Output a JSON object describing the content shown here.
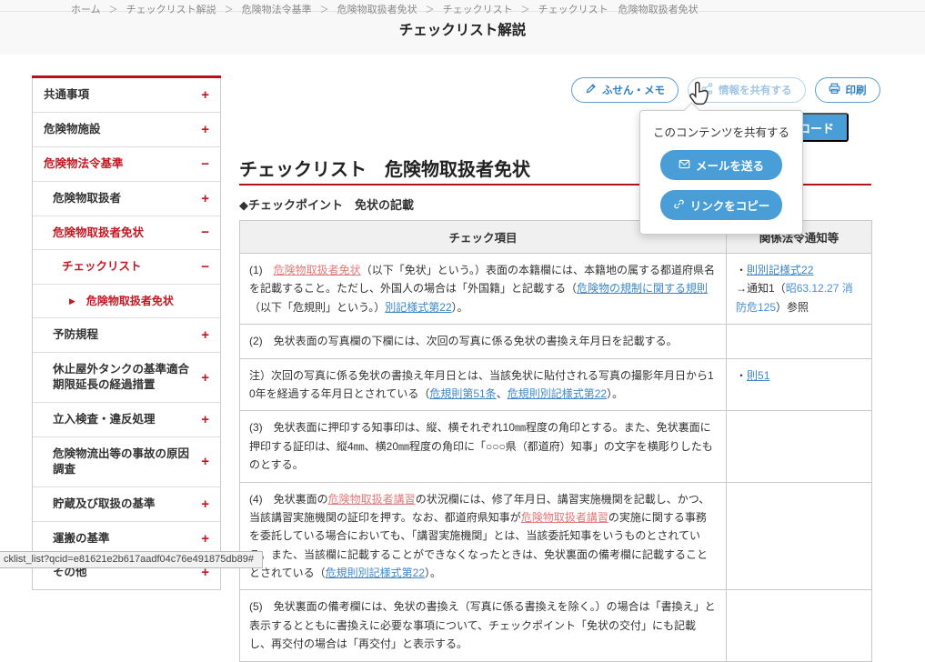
{
  "colors": {
    "accent_red": "#b5121b",
    "red_text": "#c11a24",
    "link_blue": "#3d87c9",
    "link_pink": "#e07a7a",
    "button_blue": "#4a9ed8",
    "outline_blue": "#5b9fd0",
    "header_bg": "#f8f8f8",
    "table_header_bg": "#f0f0f0"
  },
  "breadcrumb": {
    "separator": "＞",
    "items": [
      "ホーム",
      "チェックリスト解説",
      "危険物法令基準",
      "危険物取扱者免状",
      "チェックリスト",
      "チェックリスト　危険物取扱者免状"
    ]
  },
  "header": {
    "title": "チェックリスト解説"
  },
  "sidebar": {
    "items": [
      {
        "label": "共通事項",
        "level": 0,
        "red": false,
        "toggle": "+",
        "current": false
      },
      {
        "label": "危険物施設",
        "level": 0,
        "red": false,
        "toggle": "+",
        "current": false
      },
      {
        "label": "危険物法令基準",
        "level": 0,
        "red": true,
        "toggle": "−",
        "current": false
      },
      {
        "label": "危険物取扱者",
        "level": 1,
        "red": false,
        "toggle": "+",
        "current": false
      },
      {
        "label": "危険物取扱者免状",
        "level": 1,
        "red": true,
        "toggle": "−",
        "current": false
      },
      {
        "label": "チェックリスト",
        "level": 2,
        "red": true,
        "toggle": "−",
        "current": false
      },
      {
        "label": "危険物取扱者免状",
        "level": 3,
        "red": true,
        "toggle": "",
        "current": true
      },
      {
        "label": "予防規程",
        "level": 1,
        "red": false,
        "toggle": "+",
        "current": false
      },
      {
        "label": "休止屋外タンクの基準適合期限延長の経過措置",
        "level": 1,
        "red": false,
        "toggle": "+",
        "current": false
      },
      {
        "label": "立入検査・違反処理",
        "level": 1,
        "red": false,
        "toggle": "+",
        "current": false
      },
      {
        "label": "危険物流出等の事故の原因調査",
        "level": 1,
        "red": false,
        "toggle": "+",
        "current": false
      },
      {
        "label": "貯蔵及び取扱の基準",
        "level": 1,
        "red": false,
        "toggle": "+",
        "current": false
      },
      {
        "label": "運搬の基準",
        "level": 1,
        "red": false,
        "toggle": "+",
        "current": false
      },
      {
        "label": "その他",
        "level": 1,
        "red": false,
        "toggle": "+",
        "current": false
      }
    ]
  },
  "toolbar": {
    "buttons": [
      {
        "label": "ふせん・メモ",
        "icon": "pencil-icon",
        "hovered": false
      },
      {
        "label": "情報を共有する",
        "icon": "share-icon",
        "hovered": true
      },
      {
        "label": "印刷",
        "icon": "printer-icon",
        "hovered": false
      }
    ],
    "download_label": "ダウンロード"
  },
  "share_popup": {
    "title": "このコンテンツを共有する",
    "buttons": [
      {
        "label": "メールを送る",
        "icon": "mail-icon"
      },
      {
        "label": "リンクをコピー",
        "icon": "link-icon"
      }
    ]
  },
  "main": {
    "title": "チェックリスト　危険物取扱者免状",
    "checkpoint": "◆チェックポイント　免状の記載"
  },
  "table": {
    "headers": [
      "チェック項目",
      "関係法令通知等"
    ],
    "rows": [
      {
        "item": [
          {
            "t": "(1)　",
            "s": "plain"
          },
          {
            "t": "危険物取扱者免状",
            "s": "pink"
          },
          {
            "t": "（以下「免状」という。）表面の本籍欄には、本籍地の属する都道府県名を記載すること。ただし、外国人の場合は「外国籍」と記載する（",
            "s": "plain"
          },
          {
            "t": "危険物の規制に関する規則",
            "s": "blue"
          },
          {
            "t": "（以下「危規則」という。）",
            "s": "plain"
          },
          {
            "t": "別記様式第22",
            "s": "blue"
          },
          {
            "t": "）。",
            "s": "plain"
          }
        ],
        "refs": [
          [
            {
              "t": "・",
              "s": "plain"
            },
            {
              "t": "則別記様式22",
              "s": "blue"
            }
          ],
          [
            {
              "t": "→通知1（",
              "s": "plain"
            },
            {
              "t": "昭63.12.27 消防危125",
              "s": "bluetext"
            },
            {
              "t": "）参照",
              "s": "plain"
            }
          ]
        ]
      },
      {
        "item": [
          {
            "t": "(2)　免状表面の写真欄の下欄には、次回の写真に係る免状の書換え年月日を記載する。",
            "s": "plain"
          }
        ],
        "refs": []
      },
      {
        "item": [
          {
            "t": "注）次回の写真に係る免状の書換え年月日とは、当該免状に貼付される写真の撮影年月日から10年を経過する年月日とされている（",
            "s": "plain"
          },
          {
            "t": "危規則第51条",
            "s": "blue"
          },
          {
            "t": "、",
            "s": "plain"
          },
          {
            "t": "危規則別記様式第22",
            "s": "blue"
          },
          {
            "t": "）。",
            "s": "plain"
          }
        ],
        "refs": [
          [
            {
              "t": "・",
              "s": "plain"
            },
            {
              "t": "則51",
              "s": "blue"
            }
          ]
        ]
      },
      {
        "item": [
          {
            "t": "(3)　免状表面に押印する知事印は、縦、横それぞれ10㎜程度の角印とする。また、免状裏面に押印する証印は、縦4㎜、横20㎜程度の角印に「○○○県（都道府）知事」の文字を横彫りしたものとする。",
            "s": "plain"
          }
        ],
        "refs": []
      },
      {
        "item": [
          {
            "t": "(4)　免状裏面の",
            "s": "plain"
          },
          {
            "t": "危険物取扱者講習",
            "s": "pink"
          },
          {
            "t": "の状況欄には、修了年月日、講習実施機関を記載し、かつ、当該講習実施機関の証印を押す。なお、都道府県知事が",
            "s": "plain"
          },
          {
            "t": "危険物取扱者講習",
            "s": "pink"
          },
          {
            "t": "の実施に関する事務を委託している場合においても、「講習実施機関」とは、当該委託知事をいうものとされている。また、当該欄に記載することができなくなったときは、免状裏面の備考欄に記載することとされている（",
            "s": "plain"
          },
          {
            "t": "危規則別記様式第22",
            "s": "blue"
          },
          {
            "t": "）。",
            "s": "plain"
          }
        ],
        "refs": []
      },
      {
        "item": [
          {
            "t": "(5)　免状裏面の備考欄には、免状の書換え（写真に係る書換えを除く。）の場合は「書換え」と表示するとともに書換えに必要な事項について、チェックポイント「免状の交付」にも記載し、再交付の場合は「再交付」と表示する。",
            "s": "plain"
          }
        ],
        "refs": []
      }
    ]
  },
  "status_bar": {
    "text": "cklist_list?qcid=e81621e2b617aadf04c76e491875db89#"
  }
}
